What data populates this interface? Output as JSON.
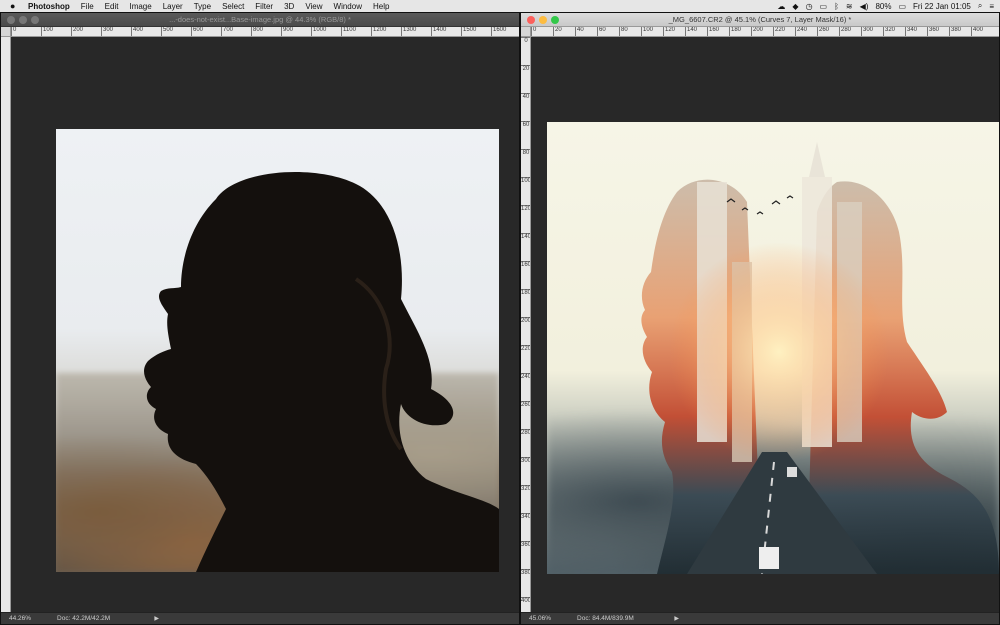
{
  "menubar": {
    "apple": "",
    "app": "Photoshop",
    "items": [
      "File",
      "Edit",
      "Image",
      "Layer",
      "Type",
      "Select",
      "Filter",
      "3D",
      "View",
      "Window",
      "Help"
    ],
    "battery": "80%",
    "datetime": "Fri 22 Jan  01:05"
  },
  "windowA": {
    "title": "...-does-not-exist...Base-image.jpg @ 44.3% (RGB/8) *",
    "ruler_h": [
      "0",
      "100",
      "200",
      "300",
      "400",
      "500",
      "600",
      "700",
      "800",
      "900",
      "1000",
      "1100",
      "1200",
      "1300",
      "1400",
      "1500",
      "1600"
    ],
    "zoom": "44.26%",
    "doc": "Doc: 42.2M/42.2M",
    "arrow": "▶"
  },
  "windowB": {
    "title": "_MG_6607.CR2 @ 45.1% (Curves 7, Layer Mask/16) *",
    "ruler_h": [
      "0",
      "20",
      "40",
      "60",
      "80",
      "100",
      "120",
      "140",
      "160",
      "180",
      "200",
      "220",
      "240",
      "260",
      "280",
      "300",
      "320",
      "340",
      "360",
      "380",
      "400"
    ],
    "ruler_v": [
      "0",
      "20",
      "40",
      "60",
      "80",
      "100",
      "120",
      "140",
      "160",
      "180",
      "200",
      "220",
      "240",
      "260",
      "280",
      "300",
      "320",
      "340",
      "360",
      "380",
      "400"
    ],
    "zoom": "45.06%",
    "doc": "Doc: 84.4M/839.9M",
    "arrow": "▶"
  },
  "colors": {
    "menubar_bg": "#e6e6e6",
    "workspace": "#282828",
    "close": "#fc605c",
    "minimize": "#fdbc40",
    "maximize": "#34c84a"
  }
}
